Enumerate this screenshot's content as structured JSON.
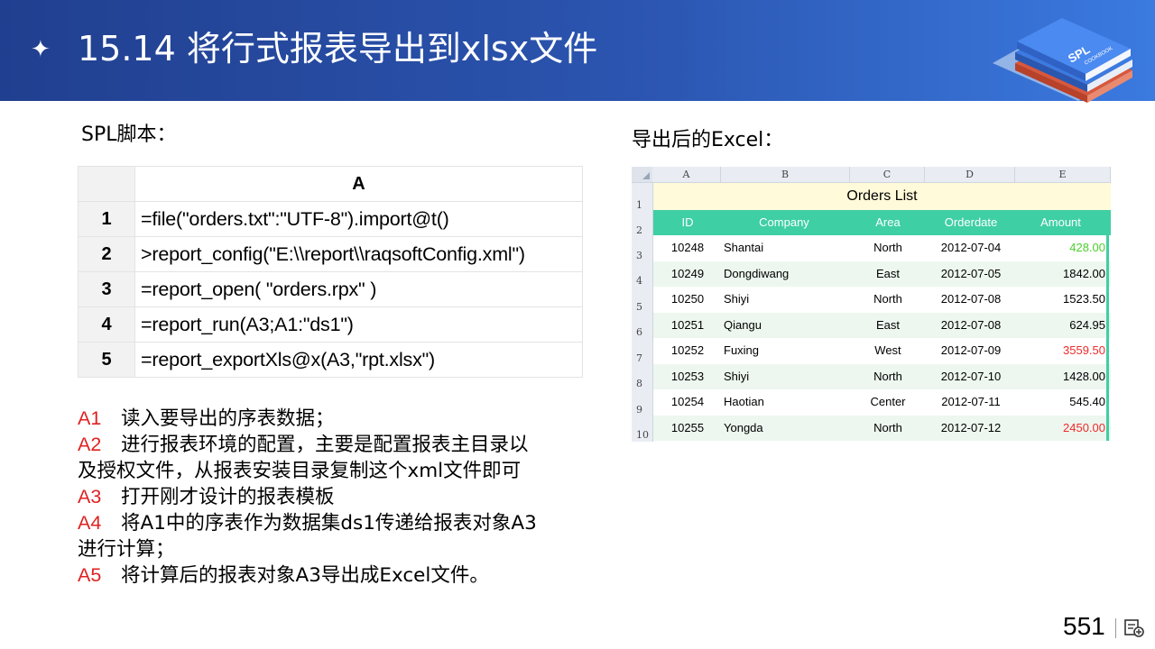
{
  "header": {
    "title": "15.14  将行式报表导出到xlsx文件",
    "logo_text_main": "SPL",
    "logo_text_sub": "COOKBOOK"
  },
  "left": {
    "label": "SPL脚本：",
    "column_header": "A",
    "rows": [
      {
        "num": "1",
        "code": "=file(\"orders.txt\":\"UTF-8\").import@t()"
      },
      {
        "num": "2",
        "code": ">report_config(\"E:\\\\report\\\\raqsoftConfig.xml\")"
      },
      {
        "num": "3",
        "code": "=report_open( \"orders.rpx\" )"
      },
      {
        "num": "4",
        "code": "=report_run(A3;A1:\"ds1\")"
      },
      {
        "num": "5",
        "code": "=report_exportXls@x(A3,\"rpt.xlsx\")"
      }
    ],
    "notes": [
      {
        "key": "A1",
        "text": "读入要导出的序表数据；"
      },
      {
        "key": "A2",
        "text": "进行报表环境的配置，主要是配置报表主目录以"
      },
      {
        "key": "",
        "text": "及授权文件，从报表安装目录复制这个xml文件即可"
      },
      {
        "key": "A3",
        "text": "打开刚才设计的报表模板"
      },
      {
        "key": "A4",
        "text": "将A1中的序表作为数据集ds1传递给报表对象A3"
      },
      {
        "key": "",
        "text": "进行计算；"
      },
      {
        "key": "A5",
        "text": "将计算后的报表对象A3导出成Excel文件。"
      }
    ]
  },
  "right": {
    "label": "导出后的Excel：",
    "excel": {
      "col_letters": [
        "A",
        "B",
        "C",
        "D",
        "E"
      ],
      "row_numbers": [
        "1",
        "2",
        "3",
        "4",
        "5",
        "6",
        "7",
        "8",
        "9",
        "10"
      ],
      "title": "Orders List",
      "headers": [
        "ID",
        "Company",
        "Area",
        "Orderdate",
        "Amount"
      ],
      "rows": [
        {
          "id": "10248",
          "company": "Shantai",
          "area": "North",
          "date": "2012-07-04",
          "amount": "428.00",
          "color": "#4ccf2c"
        },
        {
          "id": "10249",
          "company": "Dongdiwang",
          "area": "East",
          "date": "2012-07-05",
          "amount": "1842.00",
          "color": "#000000"
        },
        {
          "id": "10250",
          "company": "Shiyi",
          "area": "North",
          "date": "2012-07-08",
          "amount": "1523.50",
          "color": "#000000"
        },
        {
          "id": "10251",
          "company": "Qiangu",
          "area": "East",
          "date": "2012-07-08",
          "amount": "624.95",
          "color": "#000000"
        },
        {
          "id": "10252",
          "company": "Fuxing",
          "area": "West",
          "date": "2012-07-09",
          "amount": "3559.50",
          "color": "#f02a2a"
        },
        {
          "id": "10253",
          "company": "Shiyi",
          "area": "North",
          "date": "2012-07-10",
          "amount": "1428.00",
          "color": "#000000"
        },
        {
          "id": "10254",
          "company": "Haotian",
          "area": "Center",
          "date": "2012-07-11",
          "amount": "545.40",
          "color": "#000000"
        },
        {
          "id": "10255",
          "company": "Yongda",
          "area": "North",
          "date": "2012-07-12",
          "amount": "2450.00",
          "color": "#f02a2a"
        }
      ],
      "colors": {
        "title_bg": "#fffad9",
        "header_bg": "#3fcfa4",
        "stripe_bg": "#edf7ef"
      }
    }
  },
  "footer": {
    "page_number": "551"
  }
}
